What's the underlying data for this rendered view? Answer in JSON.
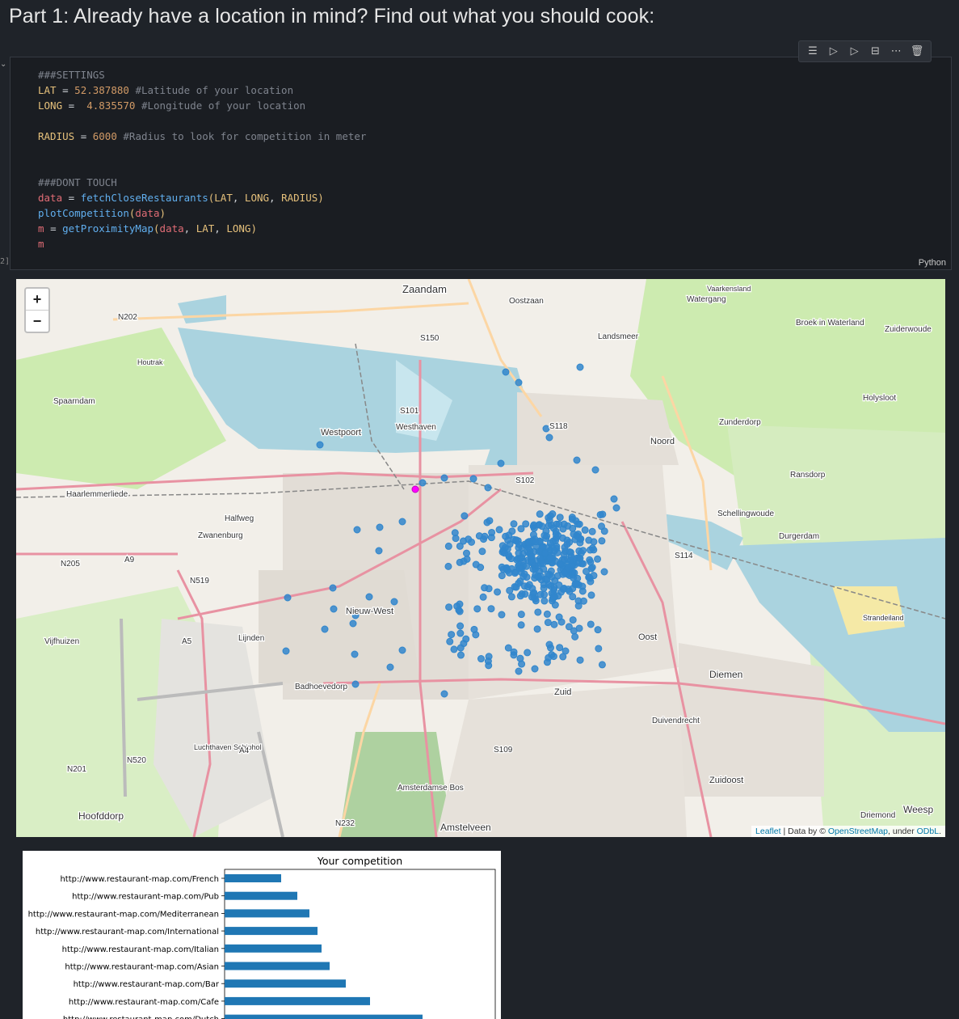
{
  "heading": "Part 1: Already have a location in mind? Find out what you should cook:",
  "toolbar": {
    "items": [
      {
        "name": "run-by-line-icon",
        "glyph": "☰"
      },
      {
        "name": "execute-above-icon",
        "glyph": "▷"
      },
      {
        "name": "execute-below-icon",
        "glyph": "▷"
      },
      {
        "name": "split-cell-icon",
        "glyph": "⊟"
      },
      {
        "name": "more-actions-icon",
        "glyph": "⋯"
      },
      {
        "name": "delete-cell-icon",
        "glyph": "🗑"
      }
    ]
  },
  "cell": {
    "exec_count": "2]",
    "language": "Python",
    "code": {
      "l1": "###SETTINGS",
      "lat_var": "LAT",
      "lat_val": "52.387880",
      "lat_com": "#Latitude of your location",
      "long_var": "LONG",
      "long_val": "4.835570",
      "long_com": "#Longitude of your location",
      "rad_var": "RADIUS",
      "rad_val": "6000",
      "rad_com": "#Radius to look for competition in meter",
      "l_dont": "###DONT TOUCH",
      "data_var": "data",
      "fetch_fn": "fetchCloseRestaurants",
      "plot_fn": "plotCompetition",
      "m_var": "m",
      "prox_fn": "getProximityMap",
      "arg_data": "data",
      "arg_lat": "LAT",
      "arg_long": "LONG",
      "arg_rad": "RADIUS"
    }
  },
  "map": {
    "zoom_in": "+",
    "zoom_out": "−",
    "attrib_leaflet": "Leaflet",
    "attrib_mid": " | Data by © ",
    "attrib_osm": "OpenStreetMap",
    "attrib_under": ", under ",
    "attrib_odbl": "ODbL",
    "attrib_end": ".",
    "labels": [
      {
        "t": "Zaandam"
      },
      {
        "t": "Oostzaan"
      },
      {
        "t": "Watergang"
      },
      {
        "t": "Vaarkensland"
      },
      {
        "t": "N202"
      },
      {
        "t": "S150"
      },
      {
        "t": "Landsmeer"
      },
      {
        "t": "Broek in Waterland"
      },
      {
        "t": "Zuiderwoude"
      },
      {
        "t": "Houtrak"
      },
      {
        "t": "Spaarndam"
      },
      {
        "t": "S101"
      },
      {
        "t": "Holysloot"
      },
      {
        "t": "Westpoort"
      },
      {
        "t": "Westhaven"
      },
      {
        "t": "S118"
      },
      {
        "t": "Zunderdorp"
      },
      {
        "t": "Noord"
      },
      {
        "t": "Ransdorp"
      },
      {
        "t": "S102"
      },
      {
        "t": "Haarlemmerliede"
      },
      {
        "t": "Schellingwoude"
      },
      {
        "t": "Halfweg"
      },
      {
        "t": "Zwanenburg"
      },
      {
        "t": "Durgerdam"
      },
      {
        "t": "N205"
      },
      {
        "t": "A9"
      },
      {
        "t": "S114"
      },
      {
        "t": "N519"
      },
      {
        "t": "Nieuw-West"
      },
      {
        "t": "Strandeiland"
      },
      {
        "t": "Vijfhuizen"
      },
      {
        "t": "A5"
      },
      {
        "t": "Lijnden"
      },
      {
        "t": "Oost"
      },
      {
        "t": "Badhoevedorp"
      },
      {
        "t": "Diemen"
      },
      {
        "t": "Zuid"
      },
      {
        "t": "Duivendrecht"
      },
      {
        "t": "Luchthaven Schiphol"
      },
      {
        "t": "A4"
      },
      {
        "t": "S109"
      },
      {
        "t": "N520"
      },
      {
        "t": "N201"
      },
      {
        "t": "Amsterdamse Bos"
      },
      {
        "t": "Zuidoost"
      },
      {
        "t": "Hoofddorp"
      },
      {
        "t": "N232"
      },
      {
        "t": "Amstelveen"
      },
      {
        "t": "Driemond"
      },
      {
        "t": "Weesp"
      }
    ]
  },
  "chart_data": {
    "type": "bar",
    "orientation": "horizontal",
    "title": "Your competition",
    "categories": [
      "http://www.restaurant-map.com/French",
      "http://www.restaurant-map.com/Pub",
      "http://www.restaurant-map.com/Mediterranean",
      "http://www.restaurant-map.com/International",
      "http://www.restaurant-map.com/Italian",
      "http://www.restaurant-map.com/Asian",
      "http://www.restaurant-map.com/Bar",
      "http://www.restaurant-map.com/Cafe",
      "http://www.restaurant-map.com/Dutch"
    ],
    "values": [
      14,
      18,
      21,
      23,
      24,
      26,
      30,
      36,
      49
    ],
    "color": "#1f77b4"
  }
}
